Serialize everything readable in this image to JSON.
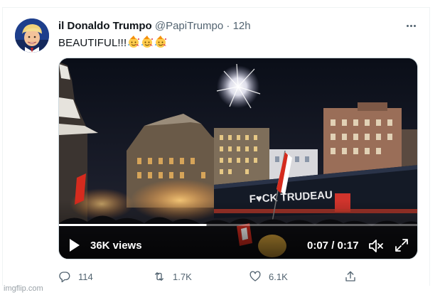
{
  "tweet": {
    "display_name": "il Donaldo Trumpo",
    "handle": "@PapiTrumpo",
    "separator": "·",
    "timestamp": "12h",
    "text": "BEAUTIFUL!!!",
    "emoji_count": 3
  },
  "media": {
    "banner_text": "F♥CK TRUDEAU",
    "views": "36K views",
    "time": "0:07 / 0:17",
    "progress_fraction": 0.41
  },
  "actions": {
    "reply_count": "114",
    "retweet_count": "1.7K",
    "like_count": "6.1K"
  },
  "watermark": "imgflip.com",
  "icons": {
    "avatar": "avatar",
    "more": "more-icon",
    "play": "play-icon",
    "mute": "mute-icon",
    "fullscreen": "fullscreen-icon",
    "reply": "reply-icon",
    "retweet": "retweet-icon",
    "like": "heart-icon",
    "share": "share-icon",
    "emoji": "party-face-emoji"
  },
  "colors": {
    "text": "#0f1419",
    "secondary": "#536471",
    "truck_text": "#e8e8ea"
  }
}
